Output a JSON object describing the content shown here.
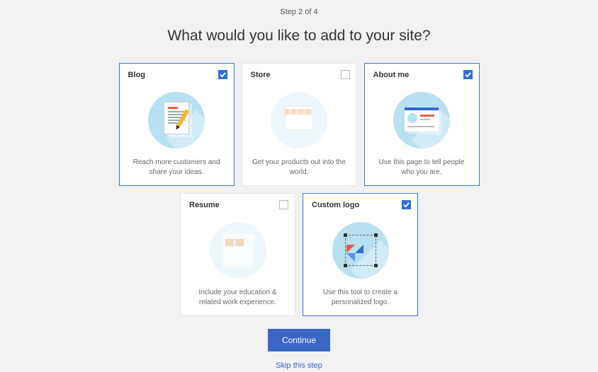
{
  "step_indicator": "Step 2 of 4",
  "heading": "What would you like to add to your site?",
  "cards": {
    "blog": {
      "title": "Blog",
      "desc": "Reach more customers and share your ideas.",
      "selected": true
    },
    "store": {
      "title": "Store",
      "desc": "Get your products out into the world.",
      "selected": false
    },
    "about": {
      "title": "About me",
      "desc": "Use this page to tell people who you are.",
      "selected": true
    },
    "resume": {
      "title": "Resume",
      "desc": "Include your education & related work experience.",
      "selected": false
    },
    "logo": {
      "title": "Custom logo",
      "desc": "Use this tool to create a personalized logo.",
      "selected": true
    }
  },
  "continue_label": "Continue",
  "skip_label": "Skip this step"
}
